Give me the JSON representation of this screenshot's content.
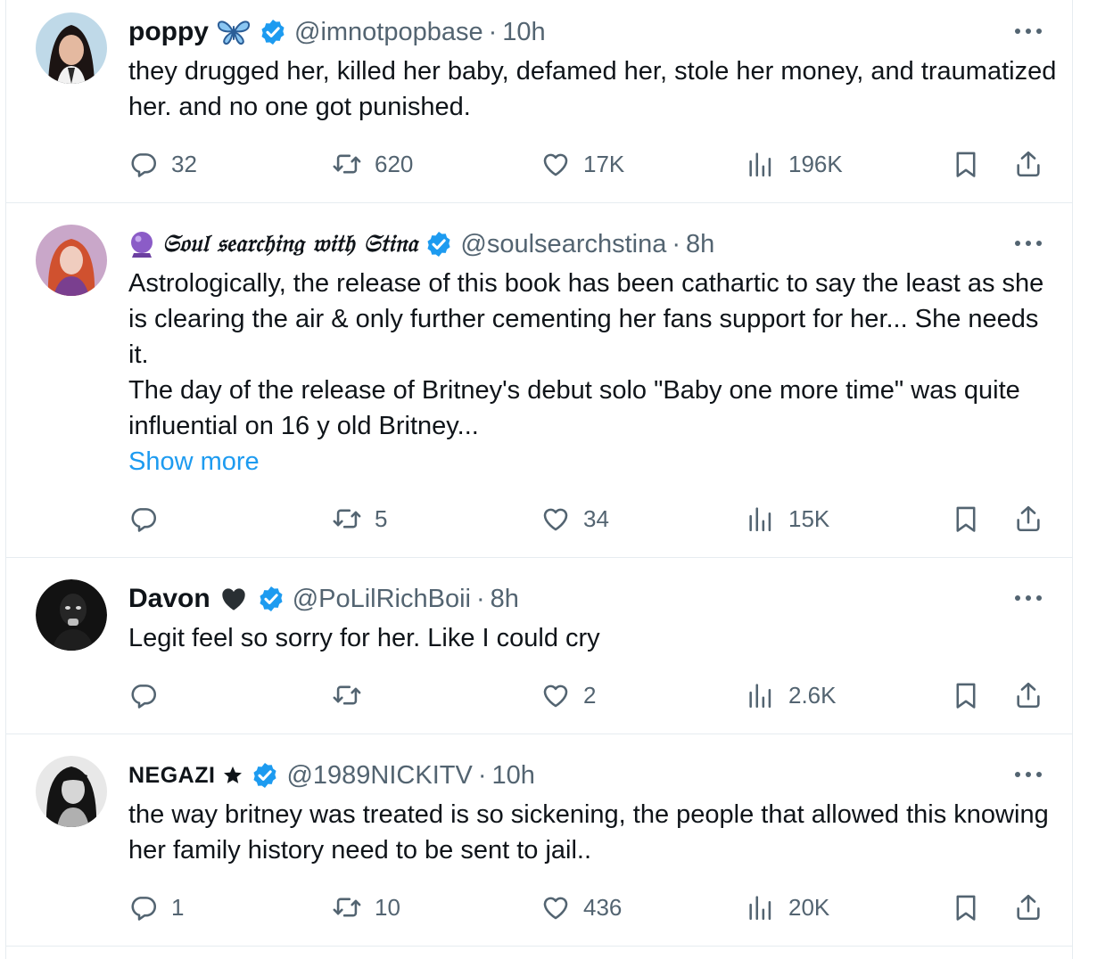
{
  "tweets": [
    {
      "name": "poppy",
      "emoji": "butterfly",
      "handle": "@imnotpopbase",
      "separator": "·",
      "time": "10h",
      "text": [
        "they drugged her, killed her baby, defamed her, stole her money, and traumatized her. and no one got punished."
      ],
      "show_more": "",
      "replies": "32",
      "reposts": "620",
      "likes": "17K",
      "views": "196K"
    },
    {
      "name": "𝔖𝔬𝔲𝔩 𝔰𝔢𝔞𝔯𝔠𝔥𝔦𝔫𝔤 𝔴𝔦𝔱𝔥 𝔖𝔱𝔦𝔫𝔞",
      "emoji": "crystal-ball",
      "handle": "@soulsearchstina",
      "separator": "·",
      "time": "8h",
      "text": [
        "Astrologically, the release of this book has been cathartic to say the least as she is clearing the air & only further cementing her fans support for her... She needs it.",
        "The day of the release of Britney's debut solo \"Baby one more time\" was quite influential on 16 y old Britney..."
      ],
      "show_more": "Show more",
      "replies": "",
      "reposts": "5",
      "likes": "34",
      "views": "15K"
    },
    {
      "name": "Davon",
      "emoji": "black-heart",
      "handle": "@PoLilRichBoii",
      "separator": "·",
      "time": "8h",
      "text": [
        "Legit feel so sorry for her. Like I could cry"
      ],
      "show_more": "",
      "replies": "",
      "reposts": "",
      "likes": "2",
      "views": "2.6K"
    },
    {
      "name": "NEGAZI",
      "emoji": "black-star",
      "handle": "@1989NICKITV",
      "separator": "·",
      "time": "10h",
      "text": [
        "the way britney was treated is so sickening, the people that allowed this knowing her family history need to be sent to jail.."
      ],
      "show_more": "",
      "replies": "1",
      "reposts": "10",
      "likes": "436",
      "views": "20K"
    }
  ],
  "colors": {
    "text": "#0f1419",
    "secondary": "#536471",
    "link": "#1d9bf0",
    "verified": "#1d9bf0",
    "divider": "#e6ecf0"
  },
  "icons": [
    "reply-icon",
    "repost-icon",
    "like-icon",
    "views-icon",
    "bookmark-icon",
    "share-icon",
    "more-icon",
    "verified-badge-icon"
  ]
}
